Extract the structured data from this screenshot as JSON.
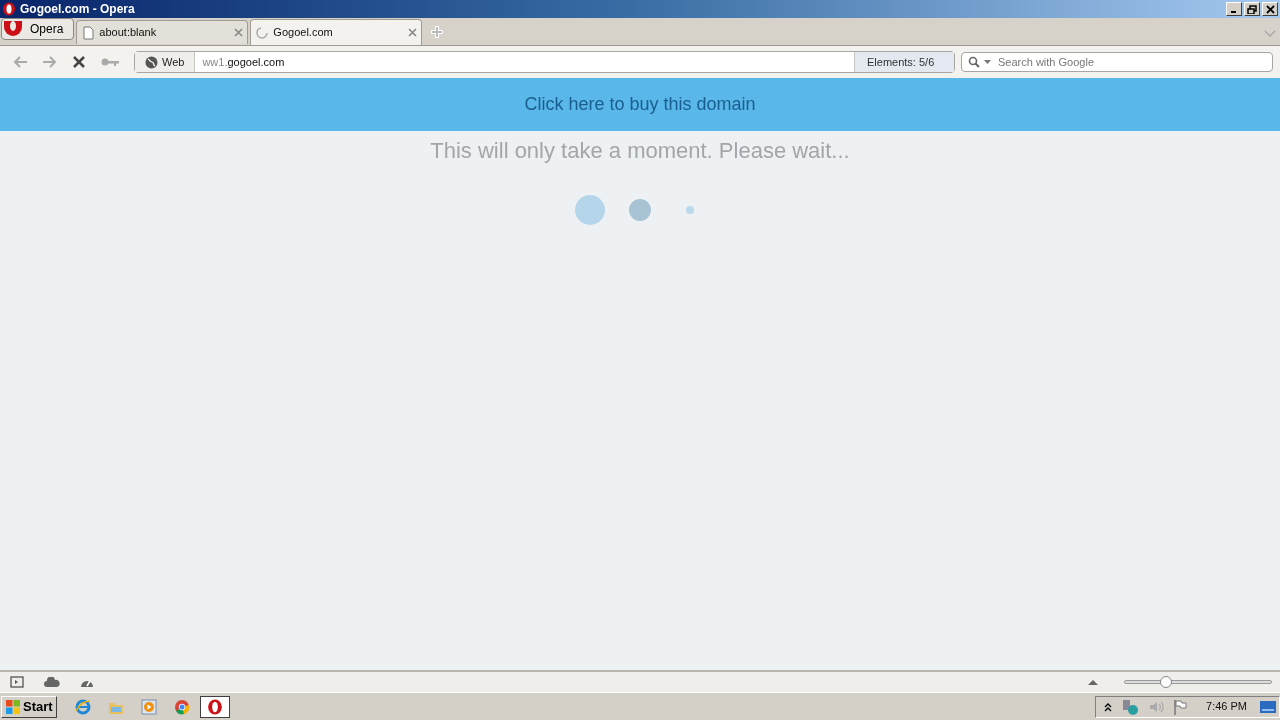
{
  "window": {
    "title": "Gogoel.com - Opera"
  },
  "menu_button": {
    "label": "Opera"
  },
  "tabs": [
    {
      "label": "about:blank",
      "selected": false,
      "loading": false
    },
    {
      "label": "Gogoel.com",
      "selected": true,
      "loading": true
    }
  ],
  "address_bar": {
    "badge": "Web",
    "value_prefix": "ww1.",
    "value_domain": "gogoel.com",
    "elements_label": "Elements:",
    "elements_count": "5/6"
  },
  "search": {
    "placeholder": "Search with Google"
  },
  "page": {
    "banner": "Click here to buy this domain",
    "message": "This will only take a moment. Please wait..."
  },
  "status_bar": {
    "zoom": {
      "level": 0.28
    }
  },
  "taskbar": {
    "start": "Start",
    "clock": "7:46 PM"
  }
}
